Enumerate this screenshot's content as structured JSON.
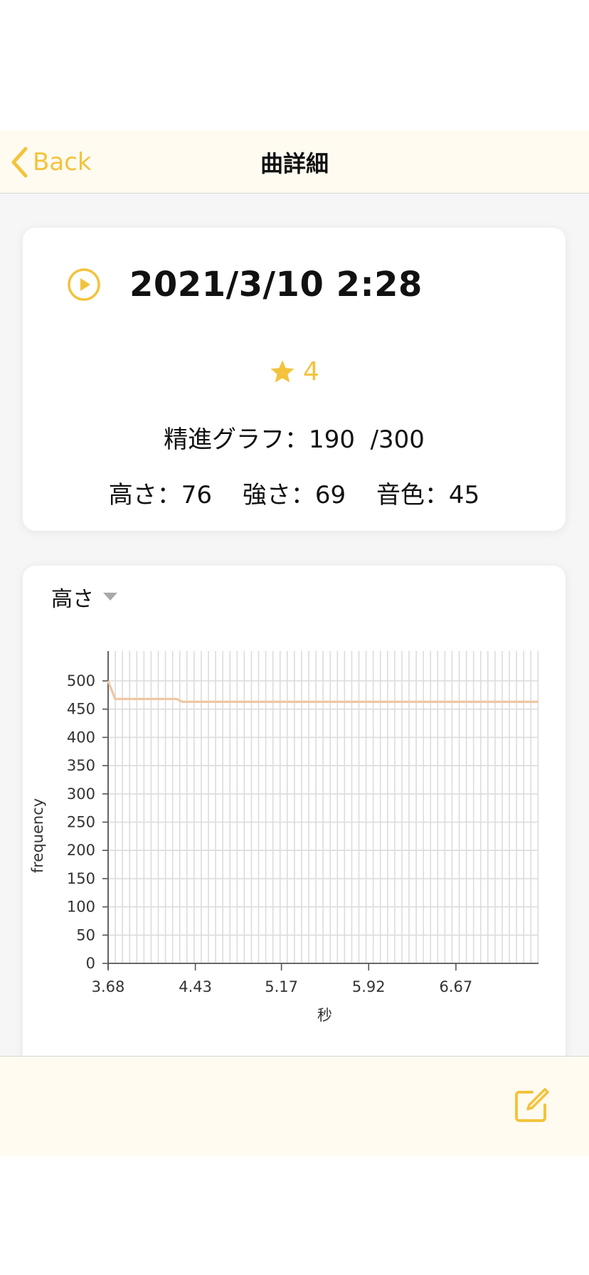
{
  "nav": {
    "back_label": "Back",
    "title": "曲詳細"
  },
  "summary": {
    "title": "2021/3/10 2:28",
    "rating": "4",
    "score_text": "精進グラフ：190  /300",
    "metrics": [
      {
        "text": "高さ：76"
      },
      {
        "text": "強さ：69"
      },
      {
        "text": "音色：45"
      }
    ]
  },
  "graph": {
    "selected_metric": "高さ"
  },
  "colors": {
    "accent": "#f3c33c",
    "line": "#efc7a4",
    "grid": "#dcdcdc",
    "bar_background": "#fffbf0"
  },
  "chart_data": {
    "type": "line",
    "xlabel": "秒",
    "ylabel": "frequency",
    "x_ticks": [
      "3.68",
      "4.43",
      "5.17",
      "5.92",
      "6.67"
    ],
    "y_ticks": [
      "0",
      "50",
      "100",
      "150",
      "200",
      "250",
      "300",
      "350",
      "400",
      "450",
      "500"
    ],
    "xlim": [
      3.68,
      7.38
    ],
    "ylim": [
      0,
      500
    ],
    "grid": true,
    "series": [
      {
        "points": [
          [
            3.68,
            500
          ],
          [
            3.74,
            468
          ],
          [
            4.27,
            468
          ],
          [
            4.32,
            463
          ],
          [
            7.38,
            463
          ]
        ]
      }
    ]
  }
}
